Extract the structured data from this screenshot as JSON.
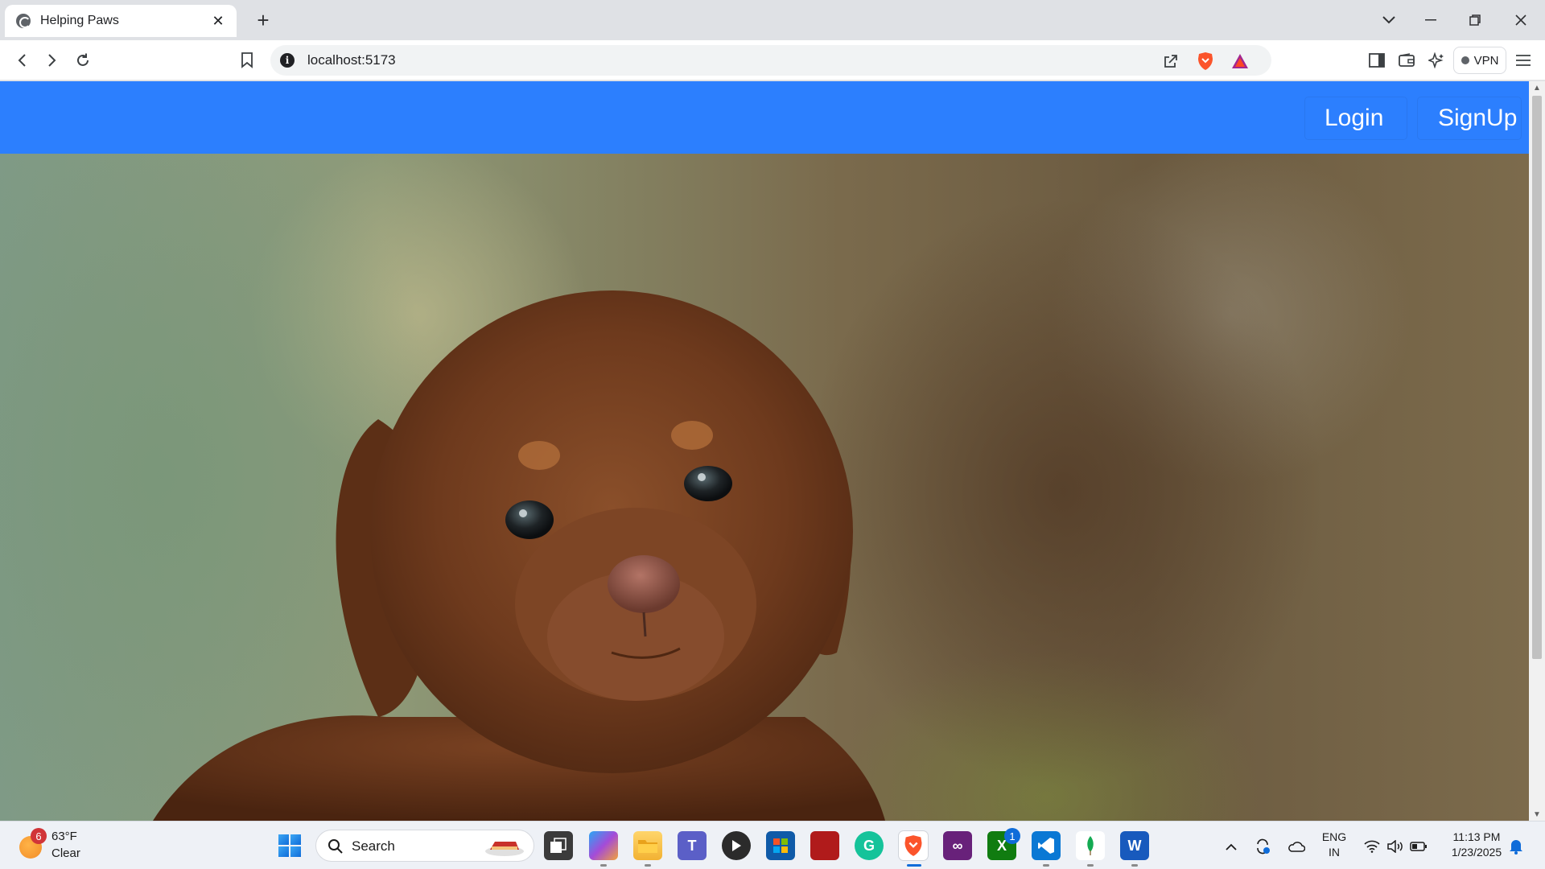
{
  "browser": {
    "tab_title": "Helping Paws",
    "url": "localhost:5173",
    "vpn_label": "VPN"
  },
  "navbar": {
    "login_label": "Login",
    "signup_label": "SignUp",
    "color": "#2c7ffe"
  },
  "taskbar": {
    "weather_badge": "6",
    "weather_temp": "63°F",
    "weather_condition": "Clear",
    "search_label": "Search",
    "teams_badge": "1",
    "language_line1": "ENG",
    "language_line2": "IN",
    "time": "11:13 PM",
    "date": "1/23/2025"
  }
}
